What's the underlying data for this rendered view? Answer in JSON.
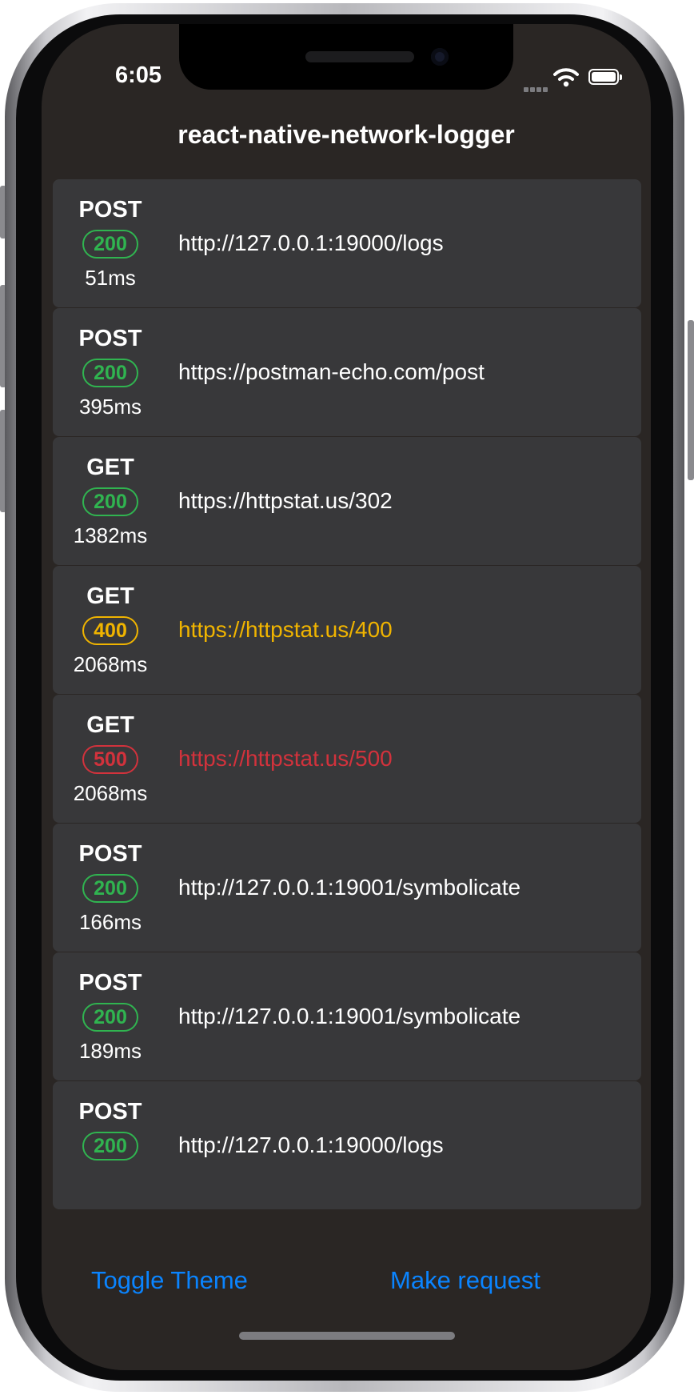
{
  "status_bar": {
    "time": "6:05"
  },
  "header": {
    "title": "react-native-network-logger"
  },
  "requests": [
    {
      "method": "POST",
      "status": "200",
      "duration": "51ms",
      "url": "http://127.0.0.1:19000/logs",
      "status_color": "#30b450",
      "url_color": "#ffffff"
    },
    {
      "method": "POST",
      "status": "200",
      "duration": "395ms",
      "url": "https://postman-echo.com/post",
      "status_color": "#30b450",
      "url_color": "#ffffff"
    },
    {
      "method": "GET",
      "status": "200",
      "duration": "1382ms",
      "url": "https://httpstat.us/302",
      "status_color": "#30b450",
      "url_color": "#ffffff"
    },
    {
      "method": "GET",
      "status": "400",
      "duration": "2068ms",
      "url": "https://httpstat.us/400",
      "status_color": "#f0b400",
      "url_color": "#f0b400"
    },
    {
      "method": "GET",
      "status": "500",
      "duration": "2068ms",
      "url": "https://httpstat.us/500",
      "status_color": "#d2323c",
      "url_color": "#d2323c"
    },
    {
      "method": "POST",
      "status": "200",
      "duration": "166ms",
      "url": "http://127.0.0.1:19001/symbolicate",
      "status_color": "#30b450",
      "url_color": "#ffffff"
    },
    {
      "method": "POST",
      "status": "200",
      "duration": "189ms",
      "url": "http://127.0.0.1:19001/symbolicate",
      "status_color": "#30b450",
      "url_color": "#ffffff"
    },
    {
      "method": "POST",
      "status": "200",
      "duration": "",
      "url": "http://127.0.0.1:19000/logs",
      "status_color": "#30b450",
      "url_color": "#ffffff"
    }
  ],
  "footer": {
    "toggle_theme": "Toggle Theme",
    "make_request": "Make request"
  }
}
